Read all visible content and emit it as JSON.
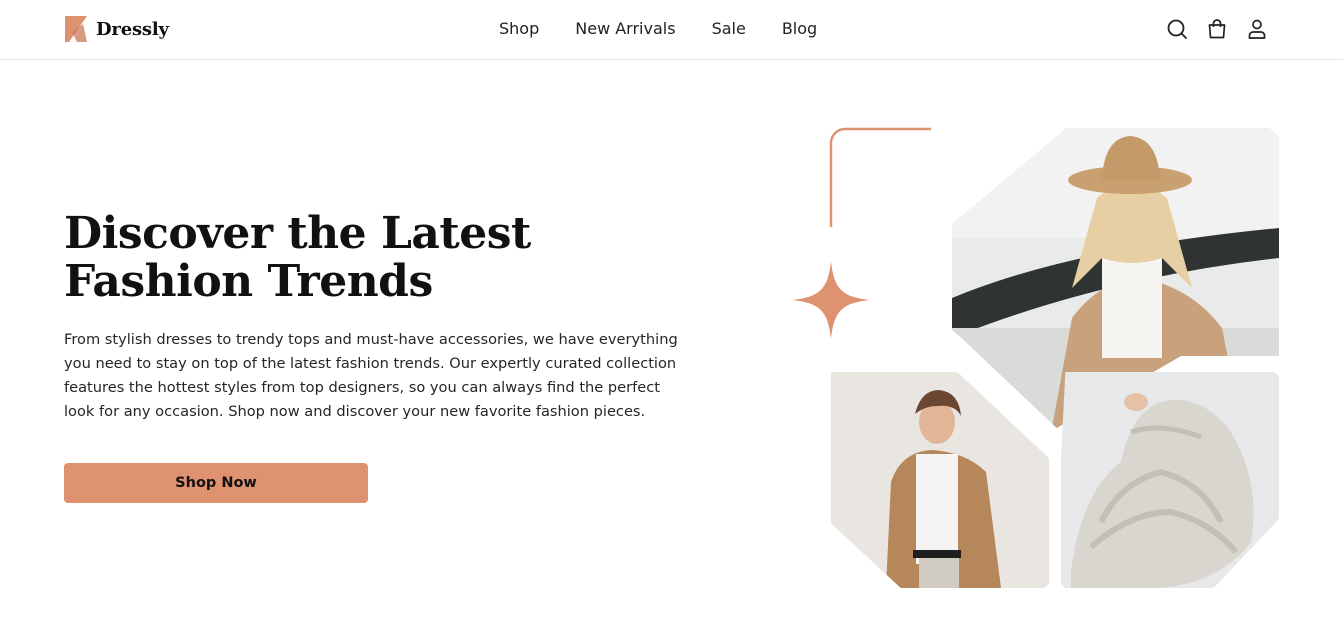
{
  "brand": {
    "name": "Dressly",
    "accent_color": "#df9270"
  },
  "nav": {
    "items": [
      {
        "label": "Shop"
      },
      {
        "label": "New Arrivals"
      },
      {
        "label": "Sale"
      },
      {
        "label": "Blog"
      }
    ]
  },
  "header_icons": [
    "search-icon",
    "shopping-bag-icon",
    "user-icon"
  ],
  "hero": {
    "title_line1": "Discover the Latest",
    "title_line2": "Fashion Trends",
    "description": "From stylish dresses to trendy tops and must-have accessories, we have everything you need to stay on top of the latest fashion trends. Our expertly curated collection features the hottest styles from top designers, so you can always find the perfect look for any occasion. Shop now and discover your new favorite fashion pieces.",
    "cta_label": "Shop Now"
  },
  "collage": {
    "images": [
      {
        "name": "woman-hat-coat-photo"
      },
      {
        "name": "man-camel-coat-photo"
      },
      {
        "name": "knit-sweater-photo"
      }
    ]
  }
}
